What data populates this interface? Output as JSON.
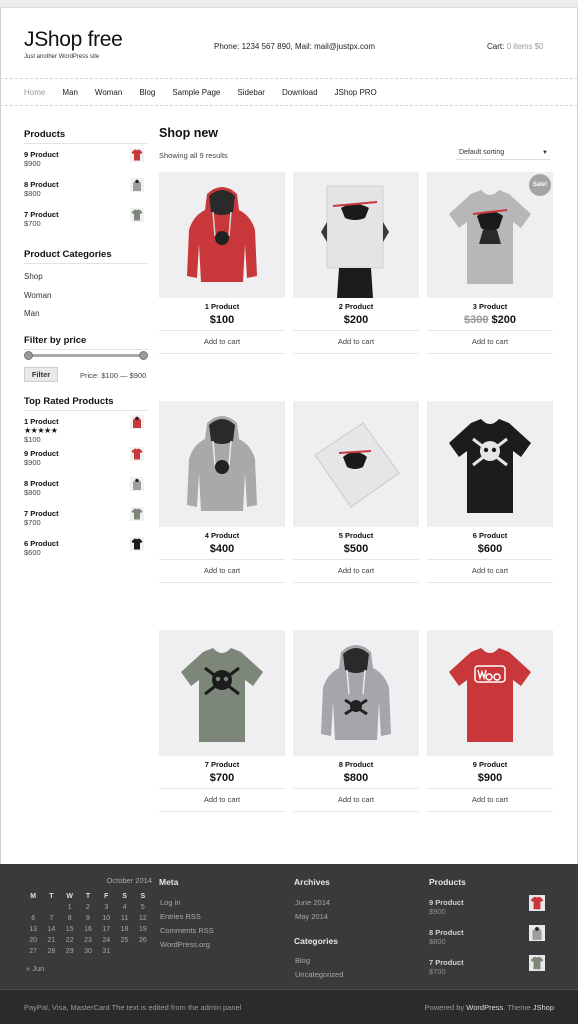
{
  "header": {
    "site_title": "JShop free",
    "tagline": "Just another WordPress site",
    "contact": "Phone: 1234 567 890, Mail: mail@justpx.com",
    "cart_label": "Cart:",
    "cart_status": "0 items $0"
  },
  "nav": [
    "Home",
    "Man",
    "Woman",
    "Blog",
    "Sample Page",
    "Sidebar",
    "Download",
    "JShop PRO"
  ],
  "sidebar": {
    "products_heading": "Products",
    "products": [
      {
        "name": "9 Product",
        "price": "$900"
      },
      {
        "name": "8 Product",
        "price": "$800"
      },
      {
        "name": "7 Product",
        "price": "$700"
      }
    ],
    "categories_heading": "Product Categories",
    "categories": [
      "Shop",
      "Woman",
      "Man"
    ],
    "filter_heading": "Filter by price",
    "filter_button": "Filter",
    "price_range": "Price: $100 — $900",
    "top_rated_heading": "Top Rated Products",
    "top_rated": [
      {
        "name": "1 Product",
        "rating": "★★★★★",
        "price": "$100"
      },
      {
        "name": "9 Product",
        "price": "$900"
      },
      {
        "name": "8 Product",
        "price": "$800"
      },
      {
        "name": "7 Product",
        "price": "$700"
      },
      {
        "name": "6 Product",
        "price": "$600"
      }
    ]
  },
  "main": {
    "title": "Shop new",
    "results": "Showing all 9 results",
    "sorting": "Default sorting",
    "sale_badge": "Sale!",
    "add_to_cart": "Add to cart",
    "products": [
      {
        "name": "1 Product",
        "price": "$100",
        "image": "red-hoodie"
      },
      {
        "name": "2 Product",
        "price": "$200",
        "image": "poster-person"
      },
      {
        "name": "3 Product",
        "old_price": "$300",
        "price": "$200",
        "image": "grey-tshirt"
      },
      {
        "name": "4 Product",
        "price": "$400",
        "image": "grey-hoodie"
      },
      {
        "name": "5 Product",
        "price": "$500",
        "image": "poster-flat"
      },
      {
        "name": "6 Product",
        "price": "$600",
        "image": "black-tshirt"
      },
      {
        "name": "7 Product",
        "price": "$700",
        "image": "green-tshirt"
      },
      {
        "name": "8 Product",
        "price": "$800",
        "image": "grey-hoodie"
      },
      {
        "name": "9 Product",
        "price": "$900",
        "image": "red-woo-tshirt"
      }
    ]
  },
  "footer": {
    "calendar": {
      "caption": "October 2014",
      "days": [
        "M",
        "T",
        "W",
        "T",
        "F",
        "S",
        "S"
      ],
      "weeks": [
        [
          "",
          "",
          "1",
          "2",
          "3",
          "4",
          "5"
        ],
        [
          "6",
          "7",
          "8",
          "9",
          "10",
          "11",
          "12"
        ],
        [
          "13",
          "14",
          "15",
          "16",
          "17",
          "18",
          "19"
        ],
        [
          "20",
          "21",
          "22",
          "23",
          "24",
          "25",
          "26"
        ],
        [
          "27",
          "28",
          "29",
          "30",
          "31",
          "",
          ""
        ]
      ],
      "prev": "« Jun"
    },
    "meta_heading": "Meta",
    "meta_links": [
      "Log in",
      "Entries RSS",
      "Comments RSS",
      "WordPress.org"
    ],
    "archives_heading": "Archives",
    "archives": [
      "June 2014",
      "May 2014"
    ],
    "categories_heading": "Categories",
    "categories": [
      "Blog",
      "Uncategorized"
    ],
    "products_heading": "Products",
    "products": [
      {
        "name": "9 Product",
        "price": "$900"
      },
      {
        "name": "8 Product",
        "price": "$800"
      },
      {
        "name": "7 Product",
        "price": "$700"
      }
    ],
    "bottom_left": "PayPal, Visa, MasterCard The text is edited from the admin panel",
    "bottom_right_prefix": "Powered by",
    "bottom_right_wp": "WordPress",
    "bottom_right_mid": ". Theme",
    "bottom_right_theme": "JShop"
  },
  "colors": {
    "accent_red": "#c8383b",
    "footer_bg": "#3a3a3c",
    "sale_badge": "#a4a4a4"
  }
}
